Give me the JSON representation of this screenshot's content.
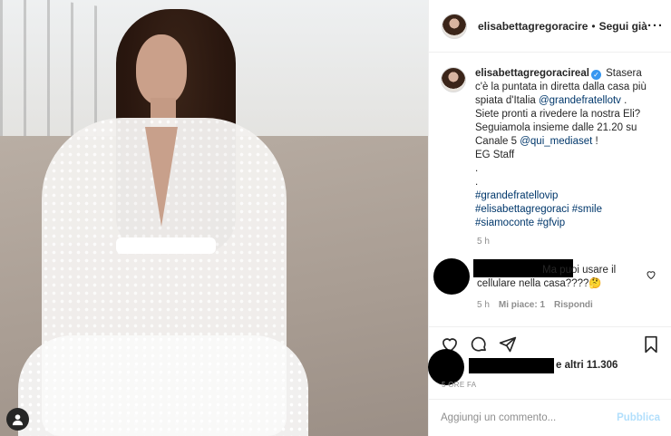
{
  "post": {
    "username": "elisabettagregoracire",
    "follow_separator": "•",
    "follow_label": "Segui già",
    "more_label": "···"
  },
  "caption": {
    "username": "elisabettagregoracireal",
    "verified_mark": "✓",
    "line1": "Stasera",
    "line2": "c'è la puntata in diretta dalla casa più",
    "line3_prefix": "spiata d'Italia ",
    "mention1": "@grandefratellotv",
    "line3_suffix": " .",
    "line4": "Siete pronti a rivedere la nostra Eli?",
    "line5": "Seguiamola insieme dalle 21.20 su",
    "line6_prefix": "Canale 5 ",
    "mention2": "@qui_mediaset",
    "line6_suffix": " !",
    "line7": "EG Staff",
    "dot1": ".",
    "dot2": ".",
    "hashtags_line1": "#grandefratellovip",
    "hashtags_line2": "#elisabettagregoraci #smile",
    "hashtags_line3": "#siamoconte #gfvip",
    "time": "5 h"
  },
  "comment": {
    "text": "Ma puoi usare il cellulare nella casa????🤔",
    "time": "5 h",
    "likes": "Mi piace: 1",
    "reply": "Rispondi"
  },
  "likes": {
    "others": "e altri 11.306",
    "ago": "5 ORE FA"
  },
  "add_comment": {
    "placeholder": "Aggiungi un commento...",
    "publish": "Pubblica"
  },
  "colors": {
    "link": "#00376b",
    "verified": "#3897f0",
    "publish_disabled": "#b2dffc",
    "muted": "#8e8e8e"
  },
  "icons": [
    "user-tag-icon",
    "more-icon",
    "heart-icon",
    "comment-icon",
    "share-icon",
    "bookmark-icon",
    "verified-icon",
    "small-heart-icon"
  ]
}
